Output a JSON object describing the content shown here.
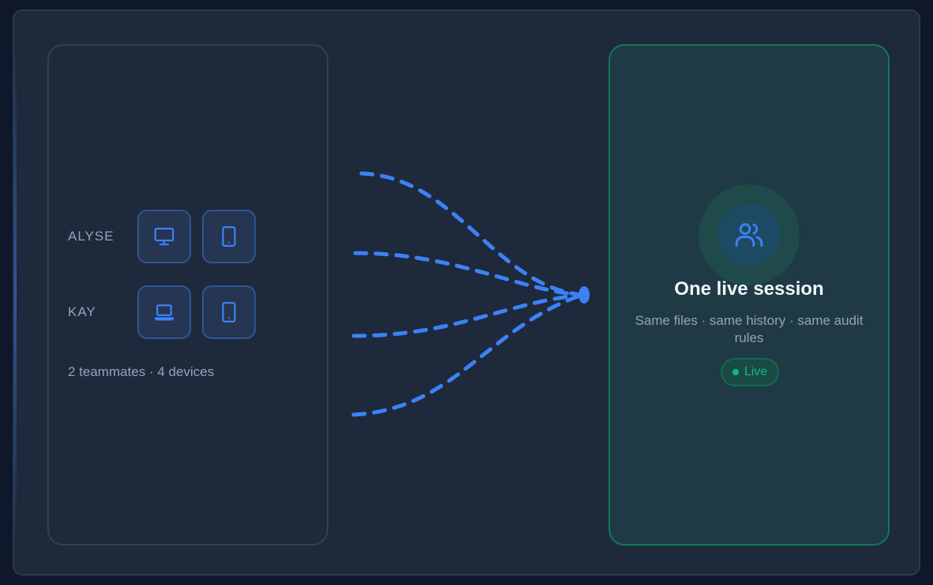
{
  "team": {
    "members": [
      {
        "name": "ALYSE",
        "devices": [
          "desktop-icon",
          "tablet-icon"
        ]
      },
      {
        "name": "KAY",
        "devices": [
          "laptop-icon",
          "tablet-icon"
        ]
      }
    ],
    "summary": "2 teammates · 4 devices"
  },
  "session": {
    "icon": "users-icon",
    "title": "One live session",
    "subtitle": "Same files · same history · same audit rules",
    "status": "Live"
  },
  "colors": {
    "background": "#1e293b",
    "accent_blue": "#3b82f6",
    "accent_green": "#10b981"
  }
}
